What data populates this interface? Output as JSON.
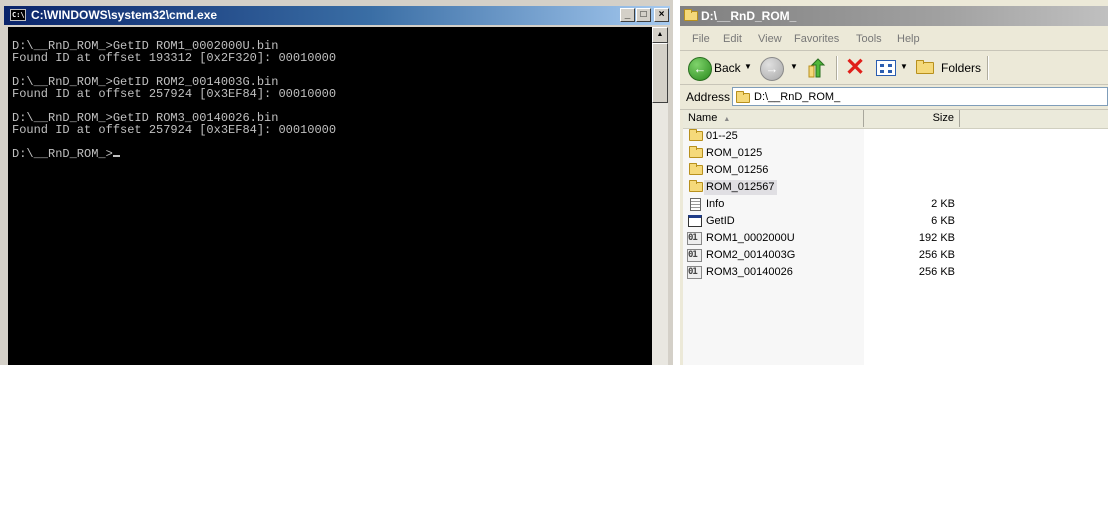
{
  "cmd": {
    "title": "C:\\WINDOWS\\system32\\cmd.exe",
    "icon_text": "C:\\",
    "buttons": {
      "minimize": "_",
      "maximize": "□",
      "close": "×"
    },
    "lines": [
      "D:\\__RnD_ROM_>GetID ROM1_0002000U.bin",
      "Found ID at offset 193312 [0x2F320]: 00010000",
      "D:\\__RnD_ROM_>GetID ROM2_0014003G.bin",
      "Found ID at offset 257924 [0x3EF84]: 00010000",
      "D:\\__RnD_ROM_>GetID ROM3_00140026.bin",
      "Found ID at offset 257924 [0x3EF84]: 00010000",
      "D:\\__RnD_ROM_>"
    ],
    "scroll_up": "▲"
  },
  "explorer": {
    "title": "D:\\__RnD_ROM_",
    "menu": [
      "File",
      "Edit",
      "View",
      "Favorites",
      "Tools",
      "Help"
    ],
    "toolbar": {
      "back_label": "Back",
      "back_glyph": "←",
      "forward_glyph": "→",
      "dropdown_glyph": "▼",
      "delete_glyph": "✕",
      "folders_label": "Folders"
    },
    "address": {
      "label": "Address",
      "value": "D:\\__RnD_ROM_"
    },
    "columns": {
      "name": "Name",
      "size": "Size",
      "sort_glyph": "▲"
    },
    "files": [
      {
        "name": "01--25",
        "size": "",
        "type": "folder",
        "selected": false
      },
      {
        "name": "ROM_0125",
        "size": "",
        "type": "folder",
        "selected": false
      },
      {
        "name": "ROM_01256",
        "size": "",
        "type": "folder",
        "selected": false
      },
      {
        "name": "ROM_012567",
        "size": "",
        "type": "folder",
        "selected": true
      },
      {
        "name": "Info",
        "size": "2 KB",
        "type": "document",
        "selected": false
      },
      {
        "name": "GetID",
        "size": "6 KB",
        "type": "executable",
        "selected": false
      },
      {
        "name": "ROM1_0002000U",
        "size": "192 KB",
        "type": "binary",
        "selected": false
      },
      {
        "name": "ROM2_0014003G",
        "size": "256 KB",
        "type": "binary",
        "selected": false
      },
      {
        "name": "ROM3_00140026",
        "size": "256 KB",
        "type": "binary",
        "selected": false
      }
    ],
    "binary_icon_text": "01"
  }
}
